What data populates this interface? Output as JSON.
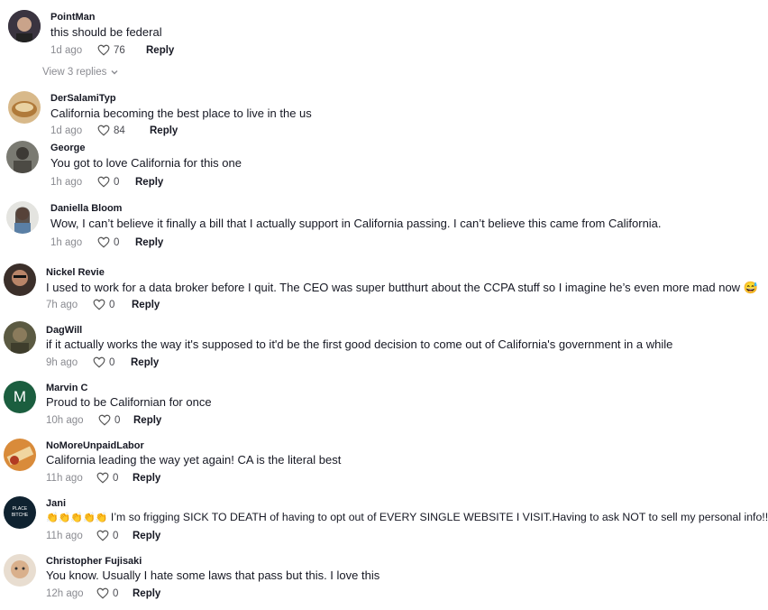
{
  "comments": [
    {
      "username": "PointMan",
      "text": "this should be federal",
      "time": "1d ago",
      "likes": "76",
      "reply": "Reply"
    },
    {
      "username": "DerSalamiTyp",
      "text": "California becoming the best place to live in the us",
      "time": "1d ago",
      "likes": "84",
      "reply": "Reply"
    },
    {
      "username": "George",
      "text": "You got to love California for this one",
      "time": "1h ago",
      "likes": "0",
      "reply": "Reply"
    },
    {
      "username": "Daniella Bloom",
      "text": "Wow, I can’t believe it finally a bill that I actually support in California passing. I can’t believe this came from California.",
      "time": "1h ago",
      "likes": "0",
      "reply": "Reply"
    },
    {
      "username": "Nickel Revie",
      "text": "I used to work for a data broker before I quit. The CEO was super butthurt about the CCPA stuff so I imagine he’s even more mad now",
      "text_suffix": "😅",
      "time": "7h ago",
      "likes": "0",
      "reply": "Reply"
    },
    {
      "username": "DagWill",
      "text": "if it actually works the way it's supposed to it'd be the first good decision to come out of California's government in a while",
      "time": "9h ago",
      "likes": "0",
      "reply": "Reply"
    },
    {
      "username": "Marvin C",
      "avatar_letter": "M",
      "text": "Proud to be Californian for once",
      "time": "10h ago",
      "likes": "0",
      "reply": "Reply"
    },
    {
      "username": "NoMoreUnpaidLabor",
      "text": "California leading the way yet again! CA is the literal best",
      "time": "11h ago",
      "likes": "0",
      "reply": "Reply"
    },
    {
      "username": "Jani",
      "avatar_text": "PLACE BITCHE",
      "text_prefix": "👏👏👏👏👏",
      "text": "I’m so frigging SICK TO DEATH of having to opt out of EVERY SINGLE WEBSITE I VISIT.Having to ask NOT to sell my personal info!!!",
      "time": "11h ago",
      "likes": "0",
      "reply": "Reply"
    },
    {
      "username": "Christopher Fujisaki",
      "text": "You know. Usually I hate some laws that pass but this. I love this",
      "time": "12h ago",
      "likes": "0",
      "reply": "Reply"
    }
  ],
  "view_replies": "View 3 replies",
  "colors": {
    "muted": "#8a8b91",
    "text": "#161823",
    "marvin_avatar": "#1b5e3f"
  }
}
